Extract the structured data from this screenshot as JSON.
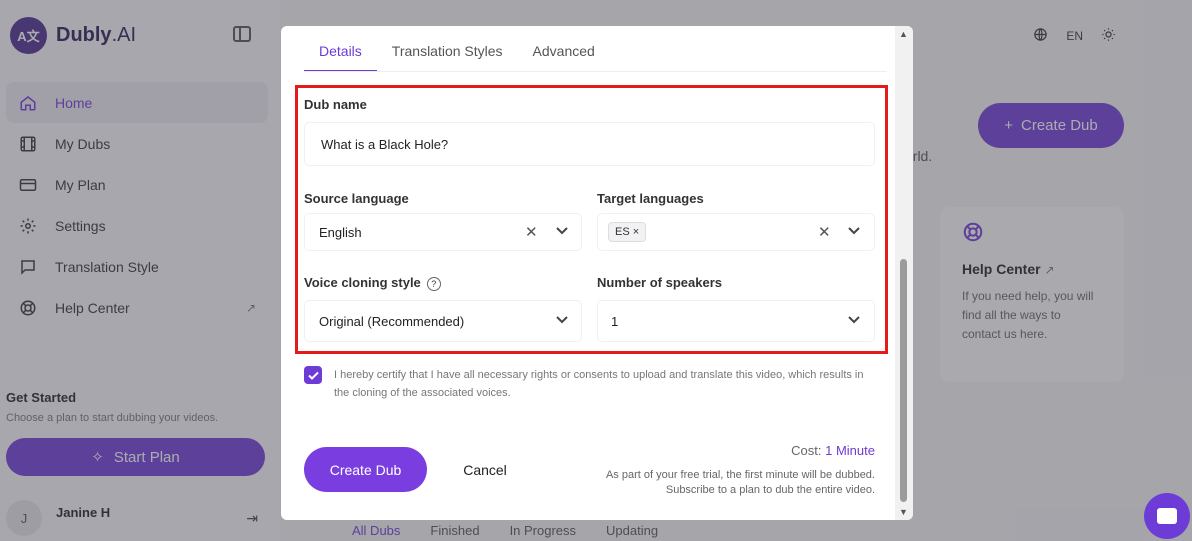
{
  "app": {
    "logo_mark": "A文",
    "brand": "Dubly",
    "brand_suffix": ".AI",
    "language": "EN"
  },
  "sidebar": {
    "items": [
      {
        "label": "Home",
        "icon": "home-icon"
      },
      {
        "label": "My Dubs",
        "icon": "film-icon"
      },
      {
        "label": "My Plan",
        "icon": "card-icon"
      },
      {
        "label": "Settings",
        "icon": "gear-icon"
      },
      {
        "label": "Translation Style",
        "icon": "message-icon"
      },
      {
        "label": "Help Center",
        "icon": "lifebuoy-icon"
      }
    ],
    "get_started_title": "Get Started",
    "get_started_sub": "Choose a plan to start dubbing your videos.",
    "start_plan_label": "Start Plan",
    "user_initial": "J",
    "user_name": "Janine H"
  },
  "main": {
    "create_dub_label": "Create Dub",
    "world_text": "orld.",
    "help_card_title": "Help Center",
    "help_card_text": "If you need help, you will find all the ways to contact us here.",
    "bottom_tabs": [
      "All Dubs",
      "Finished",
      "In Progress",
      "Updating"
    ]
  },
  "modal": {
    "tabs": [
      "Details",
      "Translation Styles",
      "Advanced"
    ],
    "dub_name_label": "Dub name",
    "dub_name_value": "What is a Black Hole?",
    "source_language_label": "Source language",
    "source_language_value": "English",
    "target_languages_label": "Target languages",
    "target_language_chip": "ES",
    "voice_cloning_label": "Voice cloning style",
    "voice_cloning_value": "Original (Recommended)",
    "speakers_label": "Number of speakers",
    "speakers_value": "1",
    "certify_text": "I hereby certify that I have all necessary rights or consents to upload and translate this video, which results in the cloning of the associated voices.",
    "create_label": "Create Dub",
    "cancel_label": "Cancel",
    "cost_label": "Cost:",
    "cost_value": "1 Minute",
    "trial_note": "As part of your free trial, the first minute will be dubbed. Subscribe to a plan to dub the entire video."
  },
  "colors": {
    "accent": "#6d3bd6",
    "highlight": "#e31b1b"
  }
}
